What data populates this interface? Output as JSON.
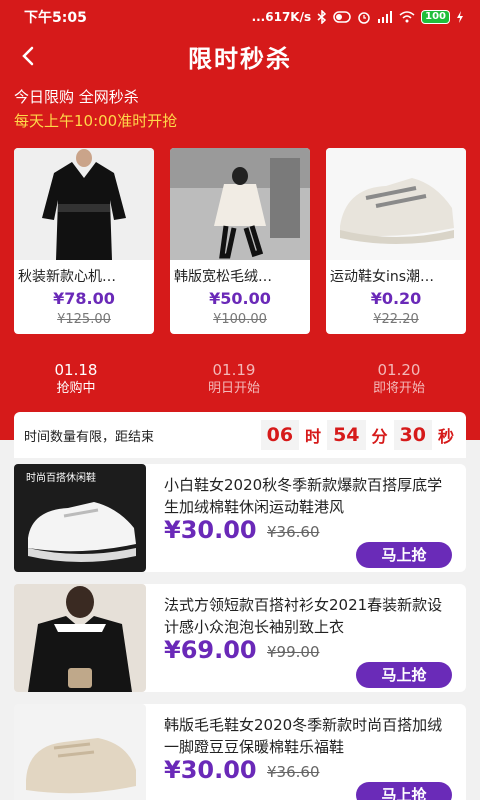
{
  "status_bar": {
    "time": "下午5:05",
    "network_speed": "...617K/s",
    "battery": "100"
  },
  "header": {
    "title": "限时秒杀"
  },
  "banner": {
    "subtitle1": "今日限购 全网秒杀",
    "subtitle2": "每天上午10:00准时开抢"
  },
  "featured": [
    {
      "title": "秋装新款心机…",
      "price": "¥78.00",
      "original_price": "¥125.00"
    },
    {
      "title": "韩版宽松毛绒…",
      "price": "¥50.00",
      "original_price": "¥100.00"
    },
    {
      "title": "运动鞋女ins潮…",
      "price": "¥0.20",
      "original_price": "¥22.20"
    }
  ],
  "day_tabs": [
    {
      "date": "01.18",
      "status": "抢购中",
      "active": true
    },
    {
      "date": "01.19",
      "status": "明日开始",
      "active": false
    },
    {
      "date": "01.20",
      "status": "即将开始",
      "active": false
    }
  ],
  "timer": {
    "label": "时间数量有限，距结束",
    "hours": "06",
    "hours_unit": "时",
    "minutes": "54",
    "minutes_unit": "分",
    "seconds": "30",
    "seconds_unit": "秒"
  },
  "items": [
    {
      "title": "小白鞋女2020秋冬季新款爆款百搭厚底学生加绒棉鞋休闲运动鞋港风",
      "price": "¥30.00",
      "original_price": "¥36.60",
      "button": "马上抢",
      "image_text": "时尚百搭休闲鞋"
    },
    {
      "title": "法式方领短款百搭衬衫女2021春装新款设计感小众泡泡长袖别致上衣",
      "price": "¥69.00",
      "original_price": "¥99.00",
      "button": "马上抢"
    },
    {
      "title": "韩版毛毛鞋女2020冬季新款时尚百搭加绒一脚蹬豆豆保暖棉鞋乐福鞋",
      "price": "¥30.00",
      "original_price": "¥36.60",
      "button": "马上抢"
    }
  ],
  "colors": {
    "brand_red": "#d61a1a",
    "price_purple": "#6a29b8",
    "highlight_yellow": "#ffd84a"
  }
}
